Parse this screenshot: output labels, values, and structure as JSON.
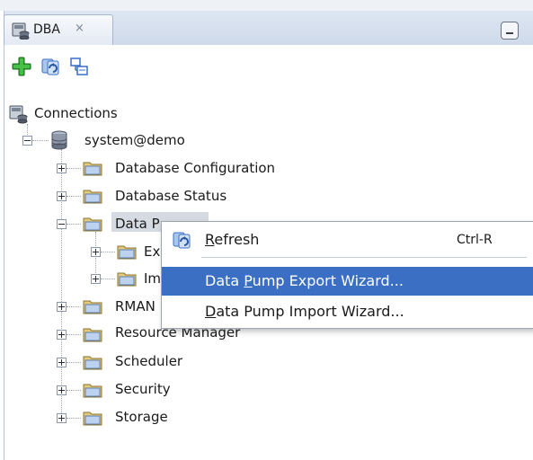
{
  "tab": {
    "label": "DBA",
    "close": "×"
  },
  "toolbar": {
    "add_icon": "add-icon",
    "refresh_icon": "refresh-icon",
    "filter_icon": "filter-icon"
  },
  "tree": {
    "root": "Connections",
    "connection": "system@demo",
    "items": [
      "Database Configuration",
      "Database Status",
      "Data P",
      "Ex",
      "Im",
      "RMAN",
      "Resource Manager",
      "Scheduler",
      "Security",
      "Storage"
    ]
  },
  "context_menu": {
    "refresh": {
      "mnemonic": "R",
      "rest": "efresh",
      "shortcut": "Ctrl-R"
    },
    "export": {
      "before": "Data ",
      "mnemonic": "P",
      "rest": "ump Export Wizard..."
    },
    "import": {
      "before": "",
      "mnemonic": "D",
      "rest": "ata Pump Import Wizard..."
    }
  },
  "colors": {
    "selection": "#3a6fc4",
    "tab_bg": "#dde6f2"
  }
}
